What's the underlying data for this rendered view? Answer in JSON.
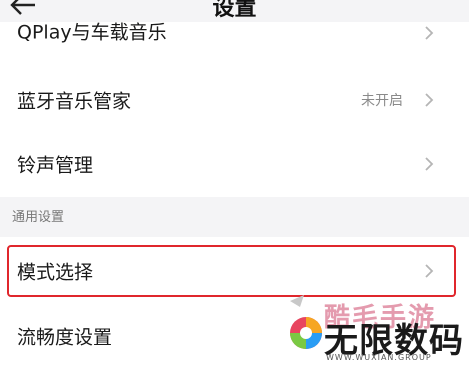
{
  "header": {
    "title": "设置",
    "back_icon": "arrow-left-icon"
  },
  "items_top": [
    {
      "label": "QPlay与车载音乐"
    },
    {
      "label": "蓝牙音乐管家",
      "value": "未开启"
    },
    {
      "label": "铃声管理"
    }
  ],
  "section": {
    "title": "通用设置"
  },
  "items_general": [
    {
      "label": "模式选择"
    },
    {
      "label": "流畅度设置"
    }
  ],
  "watermark": {
    "line1": "酷毛手游",
    "line2": "无限数码",
    "line3": "WWW.WUXIAN.GROUP"
  },
  "colors": {
    "highlight": "#e0262c",
    "background": "#f4f4f6",
    "card": "#ffffff"
  }
}
